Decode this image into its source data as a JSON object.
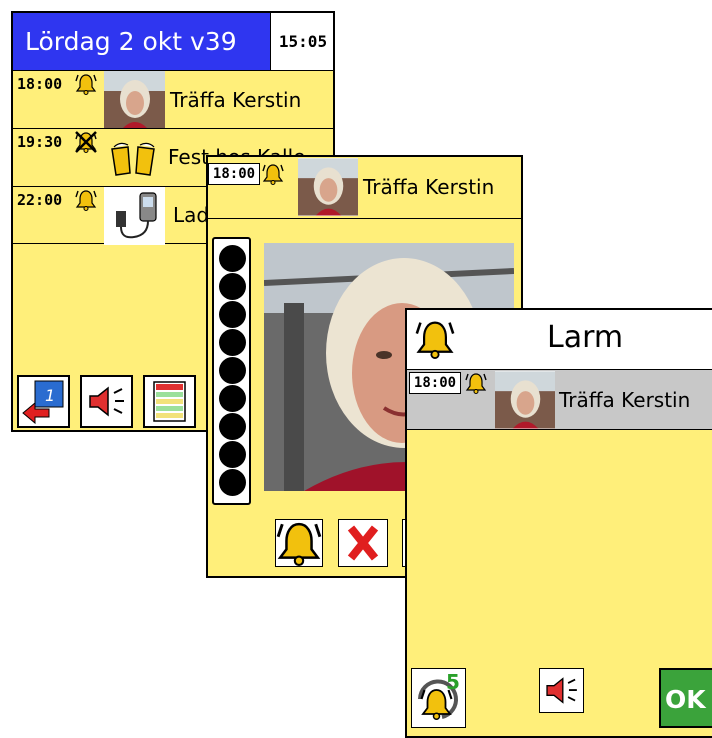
{
  "screen1": {
    "date_title": "Lördag 2 okt v39",
    "clock": "15:05",
    "events": [
      {
        "time": "18:00",
        "title": "Träffa Kerstin",
        "thumb": "person-photo",
        "alarm": "bell"
      },
      {
        "time": "19:30",
        "title": "Fest hos Kalle",
        "thumb": "beer-glasses",
        "alarm": "bell-off"
      },
      {
        "time": "22:00",
        "title": "Ladda",
        "thumb": "charger",
        "alarm": "bell"
      }
    ],
    "toolbar": [
      "back-day-icon",
      "speaker-icon",
      "list-icon"
    ]
  },
  "screen2": {
    "time": "18:00",
    "title": "Träffa Kerstin",
    "dot_count": 9,
    "buttons": [
      "bell-icon",
      "delete-icon"
    ],
    "delete_color": "#e01e1e"
  },
  "screen3": {
    "title": "Larm",
    "time": "18:00",
    "event_title": "Träffa Kerstin",
    "snooze_minutes": "5",
    "ok_label": "OK",
    "ok_color": "#3ba33b"
  },
  "colors": {
    "panel_bg": "#ffef7a",
    "header_blue": "#2f36f0"
  }
}
